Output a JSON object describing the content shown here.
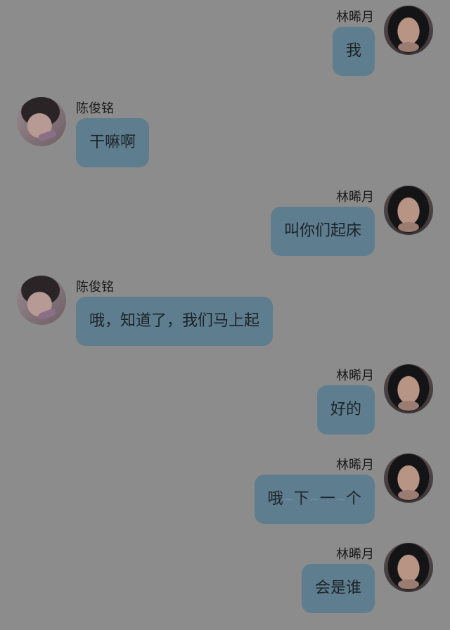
{
  "chat": {
    "messages": [
      {
        "sender": "林晞月",
        "side": "right",
        "avatar": "female-avatar",
        "text": "我"
      },
      {
        "sender": "陈俊铭",
        "side": "left",
        "avatar": "male-avatar",
        "text": "干嘛啊"
      },
      {
        "sender": "林晞月",
        "side": "right",
        "avatar": "female-avatar",
        "text": "叫你们起床"
      },
      {
        "sender": "陈俊铭",
        "side": "left",
        "avatar": "male-avatar",
        "text": "哦，知道了，我们马上起"
      },
      {
        "sender": "林晞月",
        "side": "right",
        "avatar": "female-avatar",
        "text": "好的"
      },
      {
        "sender": "林晞月",
        "side": "right",
        "avatar": "female-avatar",
        "text_parts": [
          "哦",
          "~",
          "下",
          "~",
          "一",
          "~",
          "个"
        ]
      },
      {
        "sender": "林晞月",
        "side": "right",
        "avatar": "female-avatar",
        "text": "会是谁"
      }
    ],
    "colors": {
      "background": "#8c8c8c",
      "bubble": "#5e7d8f",
      "text": "#1c2428",
      "tilde": "#6f8ea2"
    }
  }
}
